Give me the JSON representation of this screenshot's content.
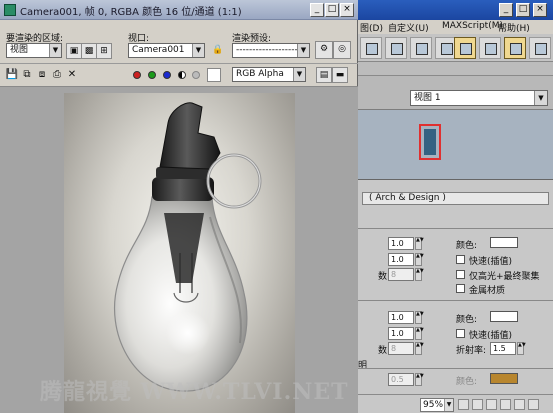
{
  "render_window": {
    "title": "Camera001, 帧 0, RGBA 颜色 16 位/通道 (1:1)",
    "area_label": "要渲染的区域:",
    "area_value": "视图",
    "viewport_label": "视口:",
    "viewport_value": "Camera001",
    "preset_label": "渲染预设:",
    "preset_value": "--------------------",
    "channel_value": "RGB Alpha",
    "channel_colors": {
      "red": "#cc2020",
      "green": "#1a9a1a",
      "blue": "#1a2ad0"
    },
    "minimize_icon": "minimize-icon",
    "maximize_icon": "maximize-icon",
    "close_icon": "close-icon"
  },
  "background_window": {
    "menu": [
      "图(D)",
      "自定义(U)",
      "MAXScript(M)",
      "帮助(H)"
    ],
    "viewport_selector": "视图 1",
    "rollout_title": "( Arch & Design )",
    "group1": {
      "spin1": "1.0",
      "spin2": "1.0",
      "spin3": "8",
      "truncated_label": "数:",
      "color_label": "颜色:",
      "opt1": "快速(插值)",
      "opt2": "仅高光+最终聚集",
      "opt3": "金属材质"
    },
    "group2": {
      "spin1": "1.0",
      "spin2": "1.0",
      "spin3": "8",
      "truncated_label": "数:",
      "color_label": "颜色:",
      "opt1": "快速(插值)",
      "ior_label": "折射率:",
      "ior_value": "1.5",
      "side_label": "明",
      "spin4": "0.5",
      "color_label2": "颜色:",
      "swatch_color": "#b8862e"
    },
    "zoom": "95%"
  },
  "watermark": "腾龍視覺 WWW.TLVI.NET"
}
